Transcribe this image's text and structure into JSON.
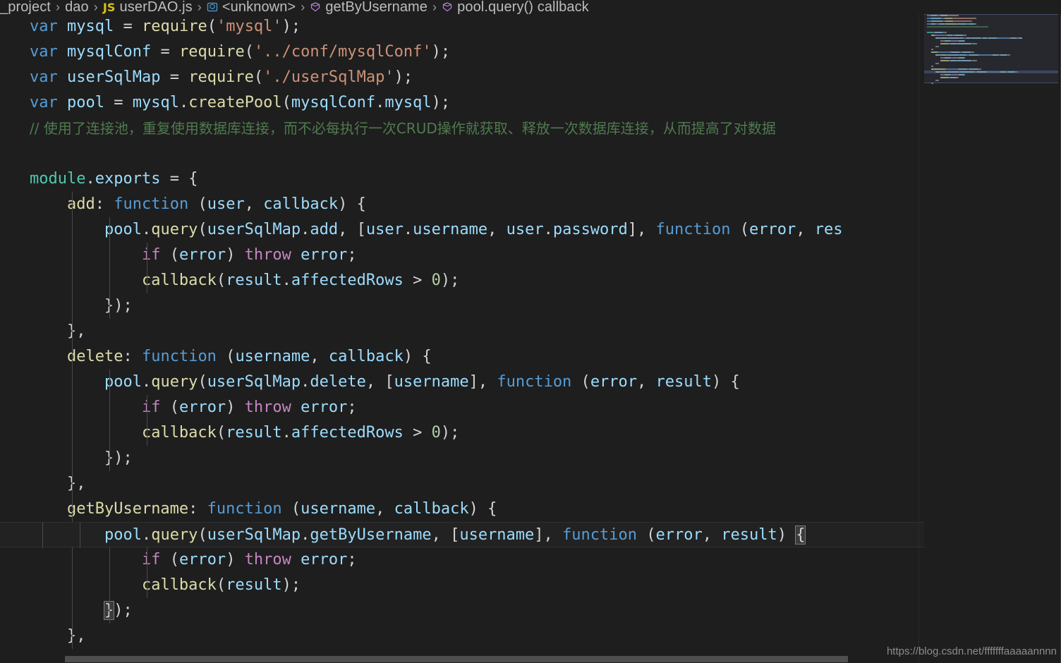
{
  "breadcrumb": {
    "segments": [
      {
        "label": "_project",
        "icon": null
      },
      {
        "label": "dao",
        "icon": null
      },
      {
        "label": "userDAO.js",
        "icon": "js-file-icon"
      },
      {
        "label": "<unknown>",
        "icon": "symbol-namespace-icon"
      },
      {
        "label": "getByUsername",
        "icon": "symbol-method-icon"
      },
      {
        "label": "pool.query() callback",
        "icon": "symbol-method-icon"
      }
    ],
    "separator": "›"
  },
  "colors": {
    "background": "#1e1e1e",
    "current_line": "#222222",
    "keyword": "#569cd6",
    "control": "#c586c0",
    "identifier": "#9cdcfe",
    "function": "#dcdcaa",
    "string": "#ce9178",
    "class": "#4ec9b0",
    "number": "#b5cea8",
    "comment": "#4f7a4f",
    "punctuation": "#d4d4d4",
    "minimap_highlight": "#363f52"
  },
  "editor": {
    "language": "JavaScript",
    "file_name": "userDAO.js",
    "current_line_index": 16,
    "lines": [
      {
        "indent": 0,
        "tokens": [
          {
            "t": "var",
            "c": "kw"
          },
          {
            "t": " ",
            "c": "punc"
          },
          {
            "t": "mysql",
            "c": "ident"
          },
          {
            "t": " = ",
            "c": "punc"
          },
          {
            "t": "require",
            "c": "fn"
          },
          {
            "t": "(",
            "c": "punc"
          },
          {
            "t": "'mysql'",
            "c": "str"
          },
          {
            "t": ");",
            "c": "punc"
          }
        ]
      },
      {
        "indent": 0,
        "tokens": [
          {
            "t": "var",
            "c": "kw"
          },
          {
            "t": " ",
            "c": "punc"
          },
          {
            "t": "mysqlConf",
            "c": "ident"
          },
          {
            "t": " = ",
            "c": "punc"
          },
          {
            "t": "require",
            "c": "fn"
          },
          {
            "t": "(",
            "c": "punc"
          },
          {
            "t": "'../conf/mysqlConf'",
            "c": "str"
          },
          {
            "t": ");",
            "c": "punc"
          }
        ]
      },
      {
        "indent": 0,
        "tokens": [
          {
            "t": "var",
            "c": "kw"
          },
          {
            "t": " ",
            "c": "punc"
          },
          {
            "t": "userSqlMap",
            "c": "ident"
          },
          {
            "t": " = ",
            "c": "punc"
          },
          {
            "t": "require",
            "c": "fn"
          },
          {
            "t": "(",
            "c": "punc"
          },
          {
            "t": "'./userSqlMap'",
            "c": "str"
          },
          {
            "t": ");",
            "c": "punc"
          }
        ]
      },
      {
        "indent": 0,
        "tokens": [
          {
            "t": "var",
            "c": "kw"
          },
          {
            "t": " ",
            "c": "punc"
          },
          {
            "t": "pool",
            "c": "ident"
          },
          {
            "t": " = ",
            "c": "punc"
          },
          {
            "t": "mysql",
            "c": "ident"
          },
          {
            "t": ".",
            "c": "punc"
          },
          {
            "t": "createPool",
            "c": "fn"
          },
          {
            "t": "(",
            "c": "punc"
          },
          {
            "t": "mysqlConf",
            "c": "ident"
          },
          {
            "t": ".",
            "c": "punc"
          },
          {
            "t": "mysql",
            "c": "ident"
          },
          {
            "t": ");",
            "c": "punc"
          }
        ]
      },
      {
        "indent": 0,
        "tokens": [
          {
            "t": "// 使用了连接池，重复使用数据库连接，而不必每执行一次CRUD操作就获取、释放一次数据库连接，从而提高了对数据",
            "c": "cmt"
          }
        ]
      },
      {
        "indent": 0,
        "tokens": []
      },
      {
        "indent": 0,
        "tokens": [
          {
            "t": "module",
            "c": "cls"
          },
          {
            "t": ".",
            "c": "punc"
          },
          {
            "t": "exports",
            "c": "ident"
          },
          {
            "t": " = {",
            "c": "punc"
          }
        ]
      },
      {
        "indent": 1,
        "tokens": [
          {
            "t": "add",
            "c": "fn"
          },
          {
            "t": ": ",
            "c": "punc"
          },
          {
            "t": "function",
            "c": "kw"
          },
          {
            "t": " (",
            "c": "punc"
          },
          {
            "t": "user",
            "c": "ident"
          },
          {
            "t": ", ",
            "c": "punc"
          },
          {
            "t": "callback",
            "c": "ident"
          },
          {
            "t": ") {",
            "c": "punc"
          }
        ]
      },
      {
        "indent": 2,
        "tokens": [
          {
            "t": "pool",
            "c": "ident"
          },
          {
            "t": ".",
            "c": "punc"
          },
          {
            "t": "query",
            "c": "fn"
          },
          {
            "t": "(",
            "c": "punc"
          },
          {
            "t": "userSqlMap",
            "c": "ident"
          },
          {
            "t": ".",
            "c": "punc"
          },
          {
            "t": "add",
            "c": "ident"
          },
          {
            "t": ", [",
            "c": "punc"
          },
          {
            "t": "user",
            "c": "ident"
          },
          {
            "t": ".",
            "c": "punc"
          },
          {
            "t": "username",
            "c": "ident"
          },
          {
            "t": ", ",
            "c": "punc"
          },
          {
            "t": "user",
            "c": "ident"
          },
          {
            "t": ".",
            "c": "punc"
          },
          {
            "t": "password",
            "c": "ident"
          },
          {
            "t": "], ",
            "c": "punc"
          },
          {
            "t": "function",
            "c": "kw"
          },
          {
            "t": " (",
            "c": "punc"
          },
          {
            "t": "error",
            "c": "ident"
          },
          {
            "t": ", ",
            "c": "punc"
          },
          {
            "t": "res",
            "c": "ident"
          }
        ]
      },
      {
        "indent": 3,
        "tokens": [
          {
            "t": "if",
            "c": "ctrl"
          },
          {
            "t": " (",
            "c": "punc"
          },
          {
            "t": "error",
            "c": "ident"
          },
          {
            "t": ") ",
            "c": "punc"
          },
          {
            "t": "throw",
            "c": "ctrl"
          },
          {
            "t": " ",
            "c": "punc"
          },
          {
            "t": "error",
            "c": "ident"
          },
          {
            "t": ";",
            "c": "punc"
          }
        ]
      },
      {
        "indent": 3,
        "tokens": [
          {
            "t": "callback",
            "c": "fn"
          },
          {
            "t": "(",
            "c": "punc"
          },
          {
            "t": "result",
            "c": "ident"
          },
          {
            "t": ".",
            "c": "punc"
          },
          {
            "t": "affectedRows",
            "c": "ident"
          },
          {
            "t": " > ",
            "c": "punc"
          },
          {
            "t": "0",
            "c": "num"
          },
          {
            "t": ");",
            "c": "punc"
          }
        ]
      },
      {
        "indent": 2,
        "tokens": [
          {
            "t": "});",
            "c": "punc"
          }
        ]
      },
      {
        "indent": 1,
        "tokens": [
          {
            "t": "},",
            "c": "punc"
          }
        ]
      },
      {
        "indent": 1,
        "tokens": [
          {
            "t": "delete",
            "c": "fn"
          },
          {
            "t": ": ",
            "c": "punc"
          },
          {
            "t": "function",
            "c": "kw"
          },
          {
            "t": " (",
            "c": "punc"
          },
          {
            "t": "username",
            "c": "ident"
          },
          {
            "t": ", ",
            "c": "punc"
          },
          {
            "t": "callback",
            "c": "ident"
          },
          {
            "t": ") {",
            "c": "punc"
          }
        ]
      },
      {
        "indent": 2,
        "tokens": [
          {
            "t": "pool",
            "c": "ident"
          },
          {
            "t": ".",
            "c": "punc"
          },
          {
            "t": "query",
            "c": "fn"
          },
          {
            "t": "(",
            "c": "punc"
          },
          {
            "t": "userSqlMap",
            "c": "ident"
          },
          {
            "t": ".",
            "c": "punc"
          },
          {
            "t": "delete",
            "c": "ident"
          },
          {
            "t": ", [",
            "c": "punc"
          },
          {
            "t": "username",
            "c": "ident"
          },
          {
            "t": "], ",
            "c": "punc"
          },
          {
            "t": "function",
            "c": "kw"
          },
          {
            "t": " (",
            "c": "punc"
          },
          {
            "t": "error",
            "c": "ident"
          },
          {
            "t": ", ",
            "c": "punc"
          },
          {
            "t": "result",
            "c": "ident"
          },
          {
            "t": ") {",
            "c": "punc"
          }
        ]
      },
      {
        "indent": 3,
        "tokens": [
          {
            "t": "if",
            "c": "ctrl"
          },
          {
            "t": " (",
            "c": "punc"
          },
          {
            "t": "error",
            "c": "ident"
          },
          {
            "t": ") ",
            "c": "punc"
          },
          {
            "t": "throw",
            "c": "ctrl"
          },
          {
            "t": " ",
            "c": "punc"
          },
          {
            "t": "error",
            "c": "ident"
          },
          {
            "t": ";",
            "c": "punc"
          }
        ]
      },
      {
        "indent": 3,
        "tokens": [
          {
            "t": "callback",
            "c": "fn"
          },
          {
            "t": "(",
            "c": "punc"
          },
          {
            "t": "result",
            "c": "ident"
          },
          {
            "t": ".",
            "c": "punc"
          },
          {
            "t": "affectedRows",
            "c": "ident"
          },
          {
            "t": " > ",
            "c": "punc"
          },
          {
            "t": "0",
            "c": "num"
          },
          {
            "t": ");",
            "c": "punc"
          }
        ]
      },
      {
        "indent": 2,
        "tokens": [
          {
            "t": "});",
            "c": "punc"
          }
        ]
      },
      {
        "indent": 1,
        "tokens": [
          {
            "t": "},",
            "c": "punc"
          }
        ]
      },
      {
        "indent": 1,
        "tokens": [
          {
            "t": "getByUsername",
            "c": "fn"
          },
          {
            "t": ": ",
            "c": "punc"
          },
          {
            "t": "function",
            "c": "kw"
          },
          {
            "t": " (",
            "c": "punc"
          },
          {
            "t": "username",
            "c": "ident"
          },
          {
            "t": ", ",
            "c": "punc"
          },
          {
            "t": "callback",
            "c": "ident"
          },
          {
            "t": ") {",
            "c": "punc"
          }
        ]
      },
      {
        "indent": 2,
        "current": true,
        "tokens": [
          {
            "t": "pool",
            "c": "ident"
          },
          {
            "t": ".",
            "c": "punc"
          },
          {
            "t": "query",
            "c": "fn"
          },
          {
            "t": "(",
            "c": "punc"
          },
          {
            "t": "userSqlMap",
            "c": "ident"
          },
          {
            "t": ".",
            "c": "punc"
          },
          {
            "t": "getByUsername",
            "c": "ident"
          },
          {
            "t": ", [",
            "c": "punc"
          },
          {
            "t": "username",
            "c": "ident"
          },
          {
            "t": "], ",
            "c": "punc"
          },
          {
            "t": "function",
            "c": "kw"
          },
          {
            "t": " (",
            "c": "punc"
          },
          {
            "t": "error",
            "c": "ident"
          },
          {
            "t": ", ",
            "c": "punc"
          },
          {
            "t": "result",
            "c": "ident"
          },
          {
            "t": ") ",
            "c": "punc"
          },
          {
            "t": "{",
            "c": "punc brk"
          }
        ]
      },
      {
        "indent": 3,
        "tokens": [
          {
            "t": "if",
            "c": "ctrl"
          },
          {
            "t": " (",
            "c": "punc"
          },
          {
            "t": "error",
            "c": "ident"
          },
          {
            "t": ") ",
            "c": "punc"
          },
          {
            "t": "throw",
            "c": "ctrl"
          },
          {
            "t": " ",
            "c": "punc"
          },
          {
            "t": "error",
            "c": "ident"
          },
          {
            "t": ";",
            "c": "punc"
          }
        ]
      },
      {
        "indent": 3,
        "tokens": [
          {
            "t": "callback",
            "c": "fn"
          },
          {
            "t": "(",
            "c": "punc"
          },
          {
            "t": "result",
            "c": "ident"
          },
          {
            "t": ");",
            "c": "punc"
          }
        ]
      },
      {
        "indent": 2,
        "tokens": [
          {
            "t": "}",
            "c": "punc brk"
          },
          {
            "t": ");",
            "c": "punc"
          }
        ]
      },
      {
        "indent": 1,
        "tokens": [
          {
            "t": "},",
            "c": "punc"
          }
        ]
      }
    ]
  },
  "minimap": {
    "slider_top": 0,
    "slider_height": 98,
    "highlight_line_index": 16
  },
  "watermark": {
    "text": "https://blog.csdn.net/fffffffaaaaannnn"
  }
}
